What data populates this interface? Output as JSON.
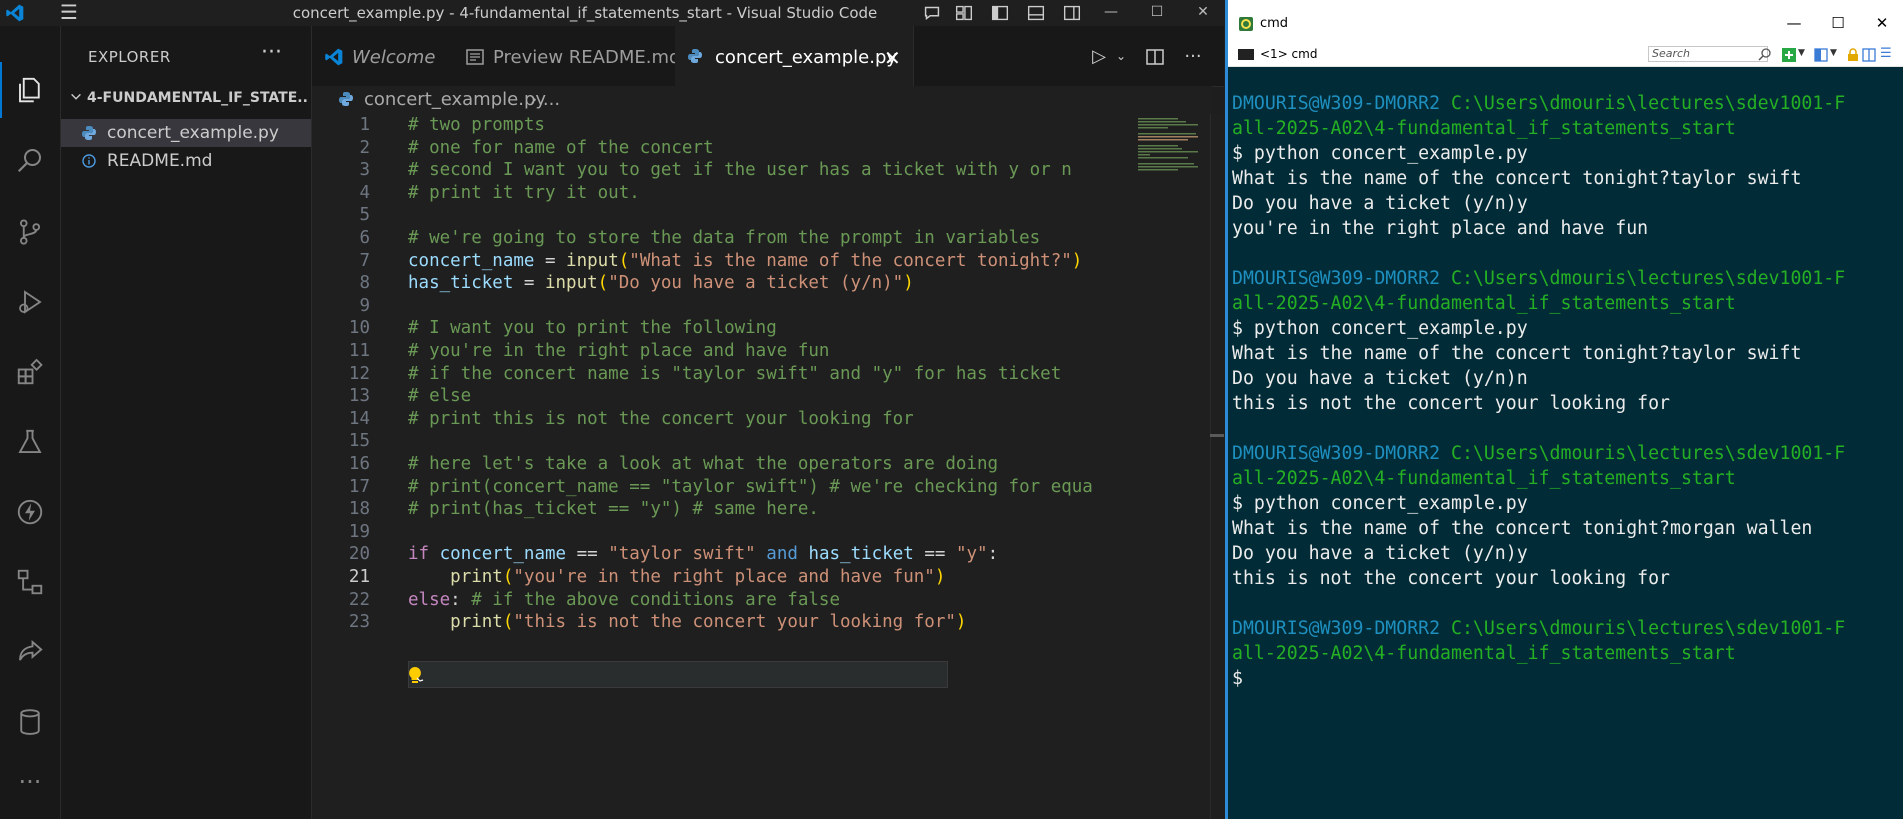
{
  "vscode": {
    "window_title": "concert_example.py - 4-fundamental_if_statements_start - Visual Studio Code",
    "explorer": {
      "title": "EXPLORER",
      "more": "···",
      "folder": "4-FUNDAMENTAL_IF_STATE...",
      "files": [
        {
          "name": "concert_example.py",
          "icon": "python-file-icon",
          "selected": true
        },
        {
          "name": "README.md",
          "icon": "info-icon",
          "selected": false
        }
      ]
    },
    "tabs": [
      {
        "label": "Welcome",
        "icon": "vscode-logo-icon",
        "active": false
      },
      {
        "label": "Preview README.md",
        "icon": "preview-icon",
        "active": false
      },
      {
        "label": "concert_example.py",
        "icon": "python-file-icon",
        "active": true,
        "close": "✕"
      }
    ],
    "breadcrumb": {
      "file": "concert_example.py",
      "rest": "› ..."
    },
    "current_line": 21,
    "code_lines": [
      {
        "n": "1",
        "tokens": [
          [
            "c-com",
            "# two prompts"
          ]
        ]
      },
      {
        "n": "2",
        "tokens": [
          [
            "c-com",
            "# one for name of the concert"
          ]
        ]
      },
      {
        "n": "3",
        "tokens": [
          [
            "c-com",
            "# second I want you to get if the user has a ticket with y or n"
          ]
        ]
      },
      {
        "n": "4",
        "tokens": [
          [
            "c-com",
            "# print it try it out."
          ]
        ]
      },
      {
        "n": "5",
        "tokens": []
      },
      {
        "n": "6",
        "tokens": [
          [
            "c-com",
            "# we're going to store the data from the prompt in variables"
          ]
        ]
      },
      {
        "n": "7",
        "tokens": [
          [
            "c-var",
            "concert_name"
          ],
          [
            "c-op",
            " = "
          ],
          [
            "c-fn",
            "input"
          ],
          [
            "c-paren",
            "("
          ],
          [
            "c-str",
            "\"What is the name of the concert tonight?\""
          ],
          [
            "c-paren",
            ")"
          ]
        ]
      },
      {
        "n": "8",
        "tokens": [
          [
            "c-var",
            "has_ticket"
          ],
          [
            "c-op",
            " = "
          ],
          [
            "c-fn",
            "input"
          ],
          [
            "c-paren",
            "("
          ],
          [
            "c-str",
            "\"Do you have a ticket (y/n)\""
          ],
          [
            "c-paren",
            ")"
          ]
        ]
      },
      {
        "n": "9",
        "tokens": []
      },
      {
        "n": "10",
        "tokens": [
          [
            "c-com",
            "# I want you to print the following"
          ]
        ]
      },
      {
        "n": "11",
        "tokens": [
          [
            "c-com",
            "# you're in the right place and have fun"
          ]
        ]
      },
      {
        "n": "12",
        "tokens": [
          [
            "c-com",
            "# if the concert name is \"taylor swift\" and \"y\" for has ticket"
          ]
        ]
      },
      {
        "n": "13",
        "tokens": [
          [
            "c-com",
            "# else"
          ]
        ]
      },
      {
        "n": "14",
        "tokens": [
          [
            "c-com",
            "# print this is not the concert your looking for"
          ]
        ]
      },
      {
        "n": "15",
        "tokens": []
      },
      {
        "n": "16",
        "tokens": [
          [
            "c-com",
            "# here let's take a look at what the operators are doing"
          ]
        ]
      },
      {
        "n": "17",
        "tokens": [
          [
            "c-com",
            "# print(concert_name == \"taylor swift\") # we're checking for equa"
          ]
        ]
      },
      {
        "n": "18",
        "tokens": [
          [
            "c-com",
            "# print(has_ticket == \"y\") # same here."
          ]
        ]
      },
      {
        "n": "19",
        "tokens": []
      },
      {
        "n": "20",
        "tokens": [
          [
            "c-kw",
            "if"
          ],
          [
            "c-op",
            " "
          ],
          [
            "c-var",
            "concert_name"
          ],
          [
            "c-op",
            " == "
          ],
          [
            "c-str",
            "\"taylor swift\""
          ],
          [
            "c-op",
            " "
          ],
          [
            "c-kw2",
            "and"
          ],
          [
            "c-op",
            " "
          ],
          [
            "c-var",
            "has_ticket"
          ],
          [
            "c-op",
            " == "
          ],
          [
            "c-str",
            "\"y\""
          ],
          [
            "c-op",
            ":"
          ]
        ]
      },
      {
        "n": "21",
        "tokens": [
          [
            "c-op",
            "    "
          ],
          [
            "c-fn",
            "print"
          ],
          [
            "c-paren",
            "("
          ],
          [
            "c-str",
            "\"you're in the right place and have fun\""
          ],
          [
            "c-paren",
            ")"
          ]
        ]
      },
      {
        "n": "22",
        "tokens": [
          [
            "c-kw",
            "else"
          ],
          [
            "c-op",
            ": "
          ],
          [
            "c-com",
            "# if the above conditions are false"
          ]
        ]
      },
      {
        "n": "23",
        "tokens": [
          [
            "c-op",
            "    "
          ],
          [
            "c-fn",
            "print"
          ],
          [
            "c-paren",
            "("
          ],
          [
            "c-str",
            "\"this is not the concert your looking for\""
          ],
          [
            "c-paren",
            ")"
          ]
        ]
      }
    ]
  },
  "cmd": {
    "title": "cmd",
    "tab_label": "<1> cmd",
    "search_placeholder": "Search",
    "lines": [
      {
        "kind": "blank",
        "text": ""
      },
      {
        "kind": "prompt1",
        "user": "DMOURIS@W309-DMORR2",
        "path": "C:\\Users\\dmouris\\lectures\\sdev1001-F"
      },
      {
        "kind": "path",
        "text": "all-2025-A02\\4-fundamental_if_statements_start"
      },
      {
        "kind": "out",
        "text": "$ python concert_example.py"
      },
      {
        "kind": "out",
        "text": "What is the name of the concert tonight?taylor swift"
      },
      {
        "kind": "out",
        "text": "Do you have a ticket (y/n)y"
      },
      {
        "kind": "out",
        "text": "you're in the right place and have fun"
      },
      {
        "kind": "blank",
        "text": ""
      },
      {
        "kind": "prompt1",
        "user": "DMOURIS@W309-DMORR2",
        "path": "C:\\Users\\dmouris\\lectures\\sdev1001-F"
      },
      {
        "kind": "path",
        "text": "all-2025-A02\\4-fundamental_if_statements_start"
      },
      {
        "kind": "out",
        "text": "$ python concert_example.py"
      },
      {
        "kind": "out",
        "text": "What is the name of the concert tonight?taylor swift"
      },
      {
        "kind": "out",
        "text": "Do you have a ticket (y/n)n"
      },
      {
        "kind": "out",
        "text": "this is not the concert your looking for"
      },
      {
        "kind": "blank",
        "text": ""
      },
      {
        "kind": "prompt1",
        "user": "DMOURIS@W309-DMORR2",
        "path": "C:\\Users\\dmouris\\lectures\\sdev1001-F"
      },
      {
        "kind": "path",
        "text": "all-2025-A02\\4-fundamental_if_statements_start"
      },
      {
        "kind": "out",
        "text": "$ python concert_example.py"
      },
      {
        "kind": "out",
        "text": "What is the name of the concert tonight?morgan wallen"
      },
      {
        "kind": "out",
        "text": "Do you have a ticket (y/n)y"
      },
      {
        "kind": "out",
        "text": "this is not the concert your looking for"
      },
      {
        "kind": "blank",
        "text": ""
      },
      {
        "kind": "prompt1",
        "user": "DMOURIS@W309-DMORR2",
        "path": "C:\\Users\\dmouris\\lectures\\sdev1001-F"
      },
      {
        "kind": "path",
        "text": "all-2025-A02\\4-fundamental_if_statements_start"
      },
      {
        "kind": "out",
        "text": "$"
      }
    ]
  },
  "colors": {
    "vscode_bg": "#1e1e1e",
    "accent": "#0078d4",
    "cmd_bg": "#012b36",
    "cmd_user": "#1e8fbf",
    "cmd_path": "#25b024"
  }
}
